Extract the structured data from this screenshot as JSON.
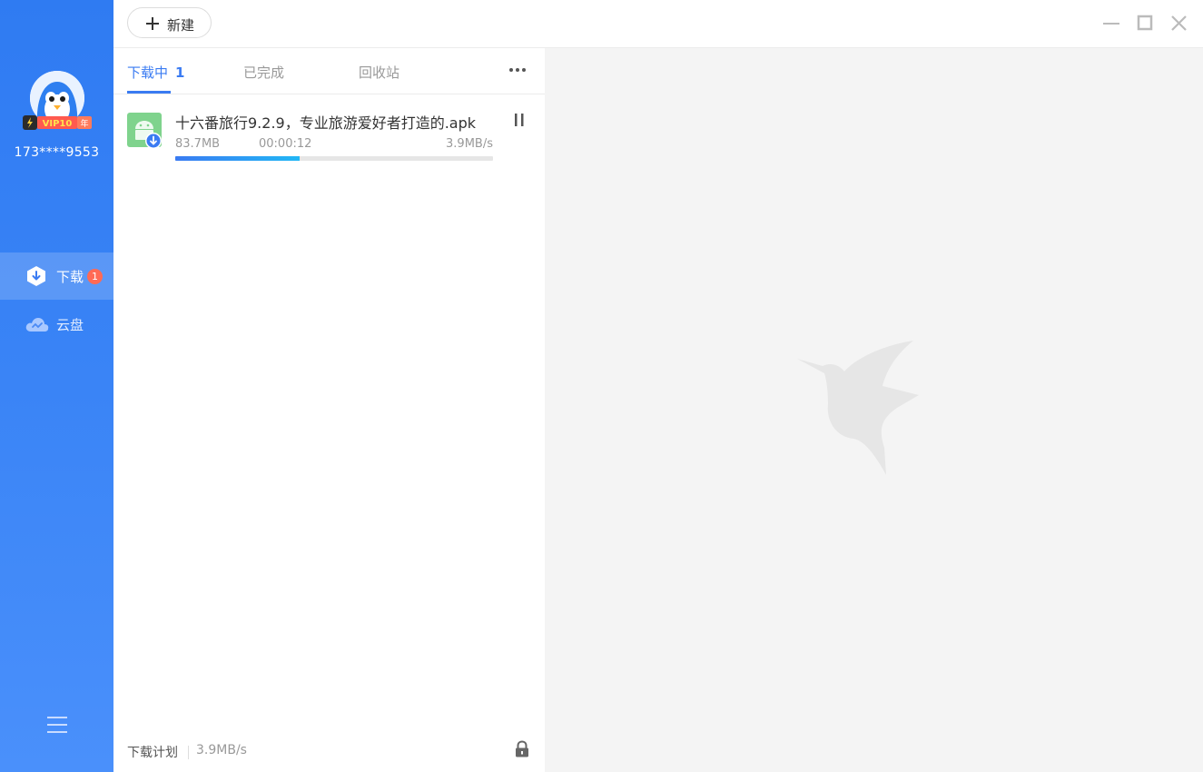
{
  "sidebar": {
    "username": "173****9553",
    "vip_badge": "VIP10",
    "vip_badge_suffix": "年",
    "nav": [
      {
        "label": "下载",
        "badge": "1"
      },
      {
        "label": "云盘"
      }
    ]
  },
  "toolbar": {
    "new_label": "新建"
  },
  "tabs": {
    "downloading": "下载中",
    "downloading_count": "1",
    "completed": "已完成",
    "recycle": "回收站"
  },
  "task": {
    "file_name": "十六番旅行9.2.9，专业旅游爱好者打造的.apk",
    "size": "83.7MB",
    "elapsed": "00:00:12",
    "speed": "3.9MB/s",
    "progress": 0.39
  },
  "footer": {
    "plan_label": "下载计划",
    "speed": "3.9MB/s"
  },
  "colors": {
    "accent": "#3a7bf2",
    "sidebar_top": "#2f7bf2",
    "badge": "#ff6a55"
  },
  "icons": [
    "plus-icon",
    "minimize-icon",
    "maximize-icon",
    "close-icon",
    "more-icon",
    "download-icon",
    "cloud-icon",
    "menu-icon",
    "android-apk-icon",
    "pause-icon",
    "lock-icon",
    "bird-logo"
  ]
}
